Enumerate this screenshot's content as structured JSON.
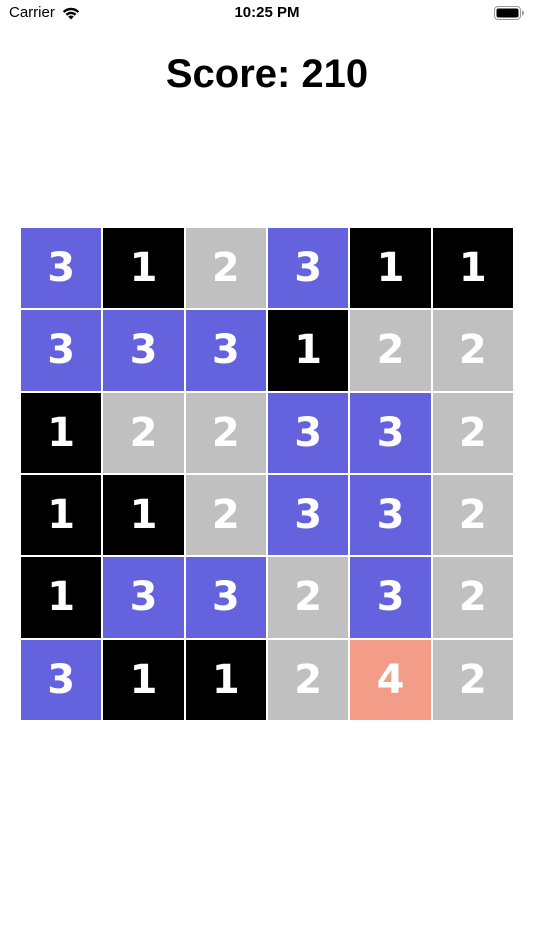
{
  "status_bar": {
    "carrier": "Carrier",
    "time": "10:25 PM",
    "wifi_icon": "wifi-icon",
    "battery_icon": "battery-full-icon"
  },
  "score_text": "Score: 210",
  "colors": {
    "1": "#000000",
    "2": "#c0c0c0",
    "3": "#6462dd",
    "4": "#f39c88",
    "tile_text": "#ffffff"
  },
  "board": [
    [
      "3",
      "1",
      "2",
      "3",
      "1",
      "1"
    ],
    [
      "3",
      "3",
      "3",
      "1",
      "2",
      "2"
    ],
    [
      "1",
      "2",
      "2",
      "3",
      "3",
      "2"
    ],
    [
      "1",
      "1",
      "2",
      "3",
      "3",
      "2"
    ],
    [
      "1",
      "3",
      "3",
      "2",
      "3",
      "2"
    ],
    [
      "3",
      "1",
      "1",
      "2",
      "4",
      "2"
    ]
  ]
}
